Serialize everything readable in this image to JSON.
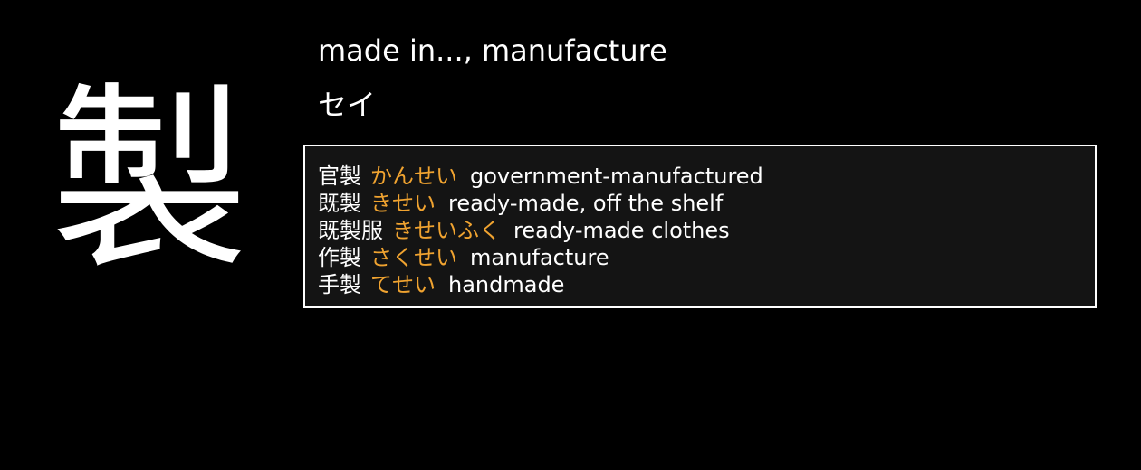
{
  "kanji": "製",
  "meaning": "made in..., manufacture",
  "reading": "セイ",
  "colors": {
    "background": "#000000",
    "text": "#ffffff",
    "kana": "#f0a330",
    "box_background": "#141414",
    "box_border": "#ffffff"
  },
  "examples": [
    {
      "word": "官製",
      "kana": "かんせい",
      "gloss": "government-manufactured"
    },
    {
      "word": "既製",
      "kana": "きせい",
      "gloss": "ready-made, off the shelf"
    },
    {
      "word": "既製服",
      "kana": "きせいふく",
      "gloss": "ready-made clothes"
    },
    {
      "word": "作製",
      "kana": "さくせい",
      "gloss": "manufacture"
    },
    {
      "word": "手製",
      "kana": "てせい",
      "gloss": "handmade"
    }
  ]
}
